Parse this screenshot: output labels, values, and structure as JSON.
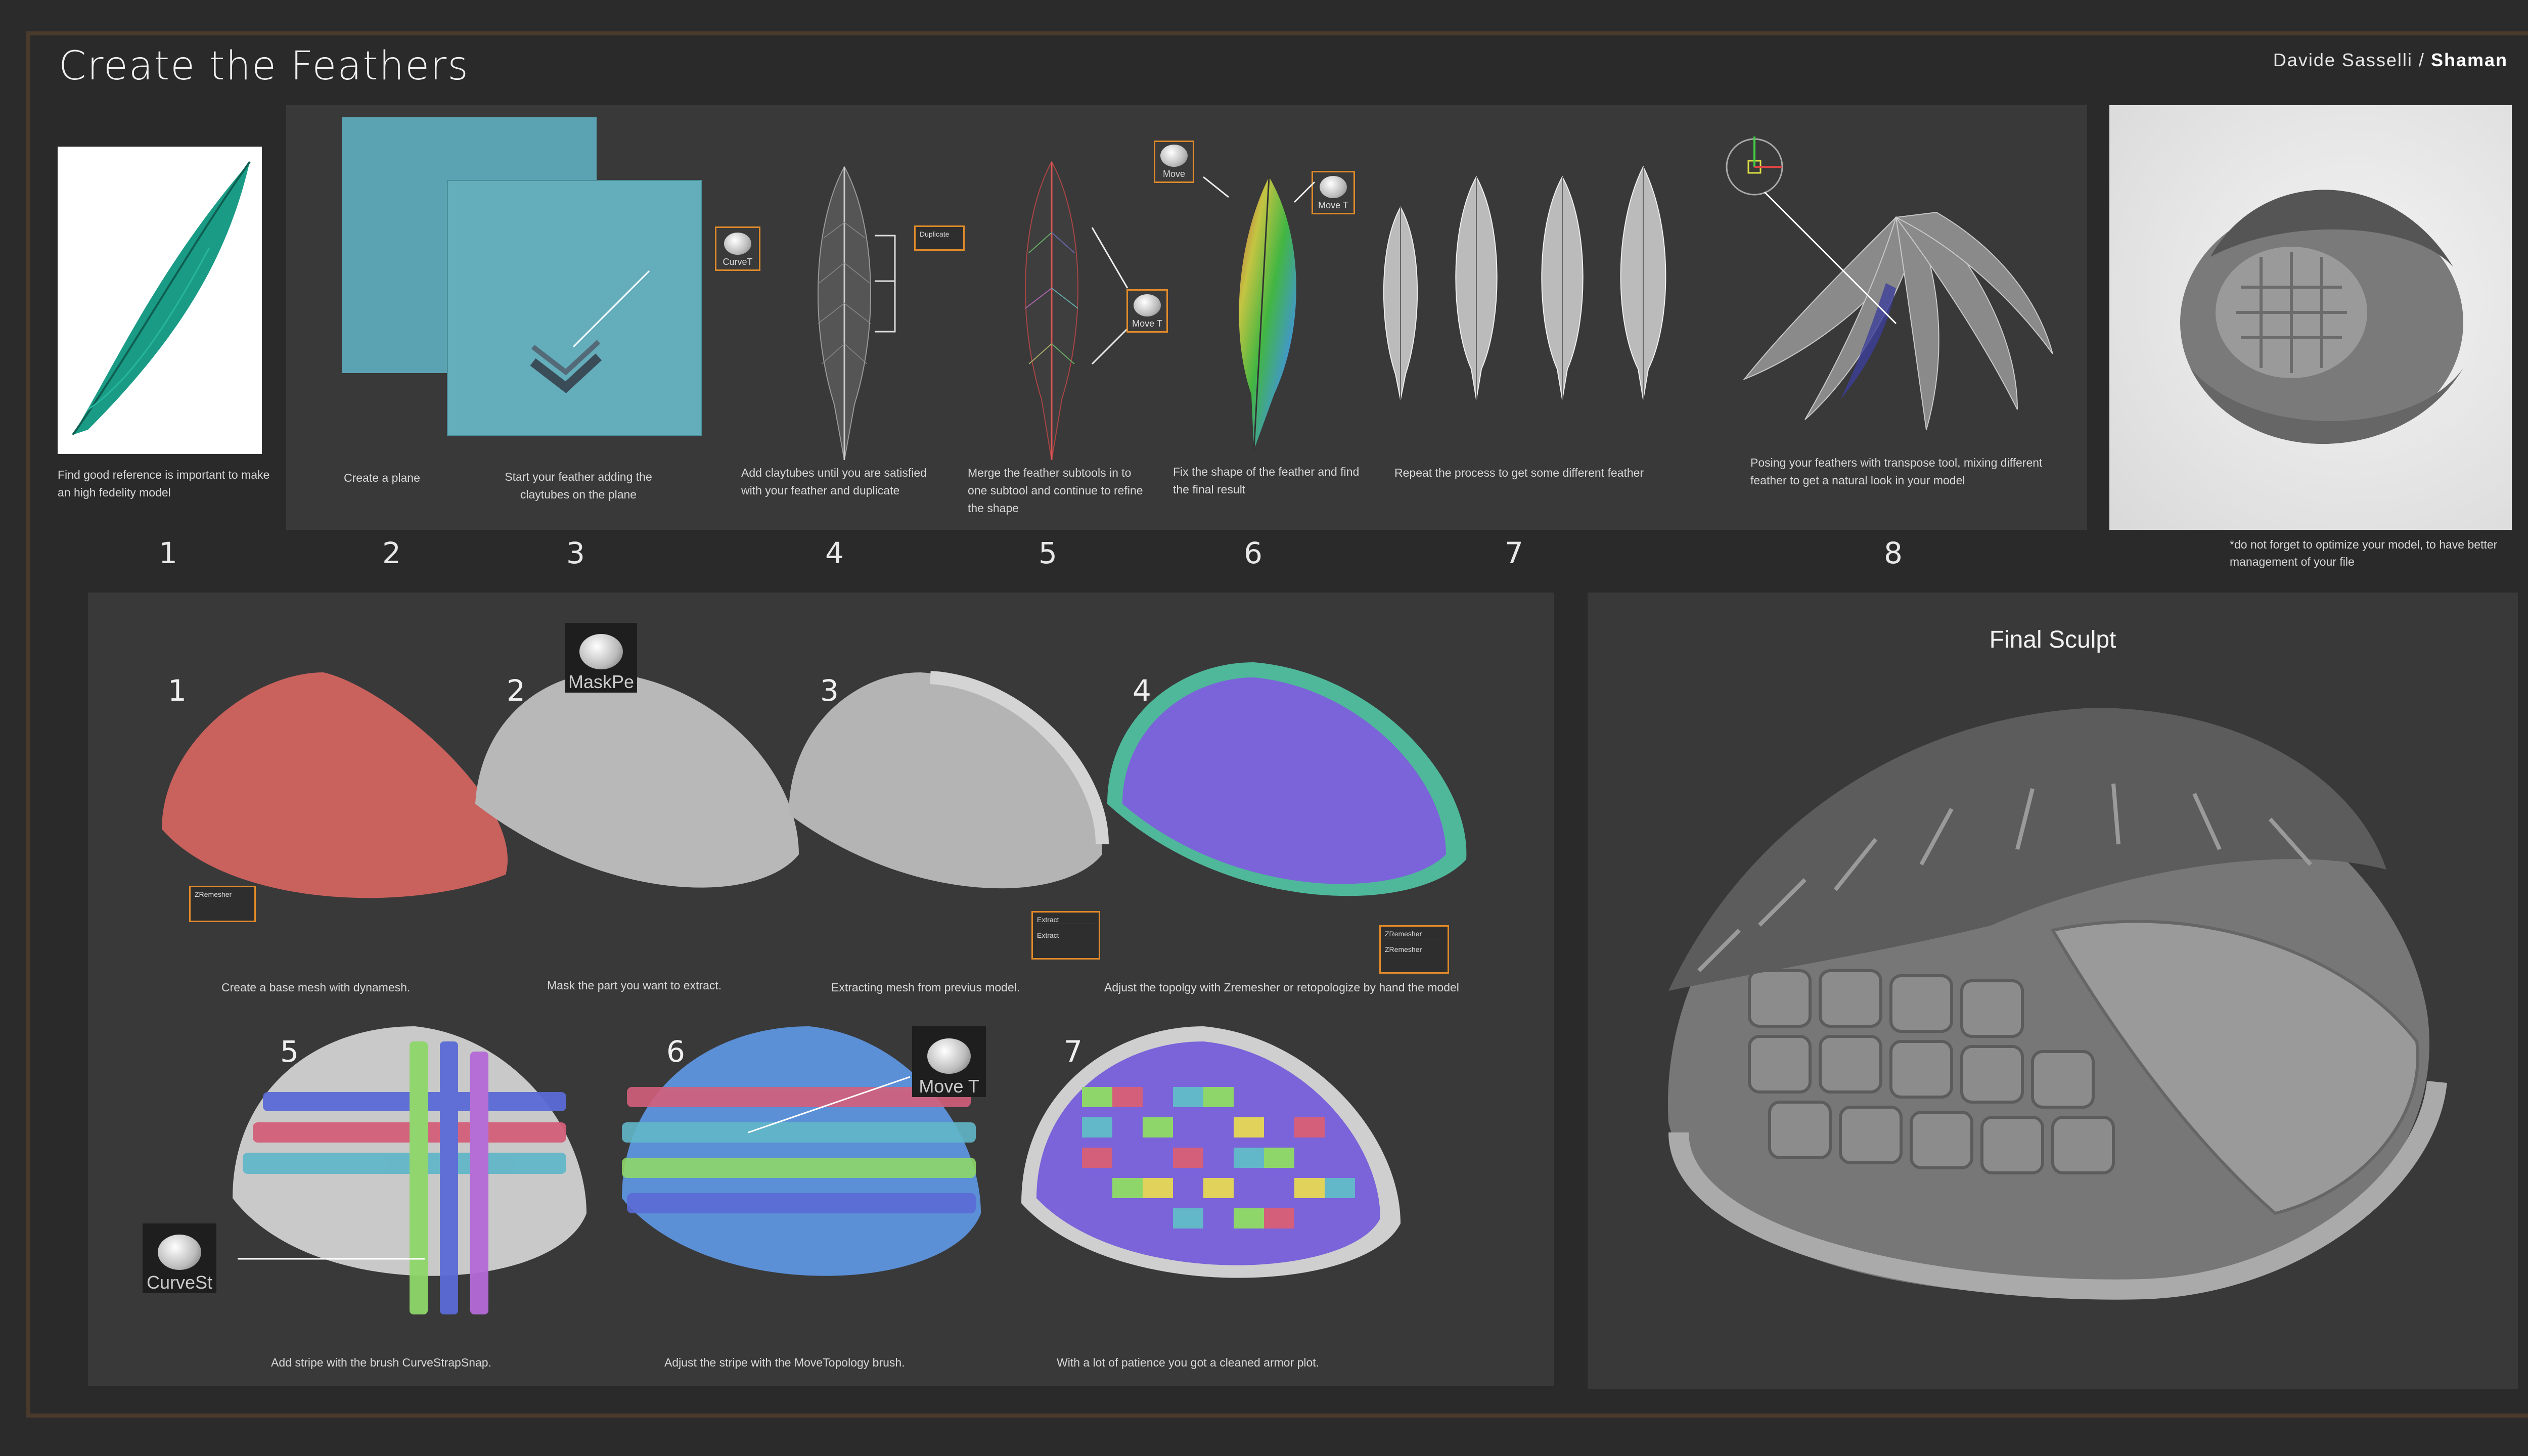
{
  "header": {
    "title": "Create the Feathers",
    "author_name": "Davide Sasselli /",
    "project": "Shaman"
  },
  "top_steps": {
    "numbers": [
      "1",
      "2",
      "3",
      "4",
      "5",
      "6",
      "7",
      "8"
    ],
    "captions": {
      "s1": "Find good reference is important to make an high fedelity model",
      "s2": "Create a plane",
      "s3": "Start your feather adding the claytubes on the plane",
      "s4": "Add claytubes until you are satisfied with your feather and duplicate",
      "s5": "Merge the feather subtools in to one subtool and continue to refine the shape",
      "s6": "Fix the shape of the feather and find the final result",
      "s7": "Repeat the process to get some different feather",
      "s8": "Posing your feathers with transpose tool, mixing different feather to get a natural look in your model"
    },
    "brushes": {
      "curve": "CurveT",
      "move_a": "Move T",
      "move_b": "Move",
      "move_c": "Move T"
    },
    "duplicate_tag": "Duplicate",
    "note": "do not forget to optimize your model, to have better management of your file"
  },
  "bottom_steps": {
    "numbers": [
      "1",
      "2",
      "3",
      "4",
      "5",
      "6",
      "7"
    ],
    "captions": {
      "b1": "Create a base mesh with dynamesh.",
      "b2": "Mask the part you want to extract.",
      "b3": "Extracting mesh from previus model.",
      "b4": "Adjust the topolgy with Zremesher or retopologize by hand the model",
      "b5": "Add stripe with the brush CurveStrapSnap.",
      "b6": "Adjust the stripe with the MoveTopology brush.",
      "b7": "With a lot of patience you got a cleaned armor plot."
    },
    "tags": {
      "zremesher1": "ZRemesher",
      "extract_title": "Extract",
      "extract_btn": "Extract",
      "zremesher_title": "ZRemesher",
      "zremesher_btn": "ZRemesher"
    },
    "brushes": {
      "mask": "MaskPe",
      "curve": "CurveSt",
      "move": "Move T"
    }
  },
  "final": {
    "title": "Final Sculpt"
  },
  "colors": {
    "frame": "#4a3a2c",
    "accent": "#e08a2a",
    "feather_teal": "#1a9b86",
    "mesh_red": "#c9615d",
    "mesh_purple": "#7b63d9",
    "mesh_teal": "#4fb79a"
  }
}
